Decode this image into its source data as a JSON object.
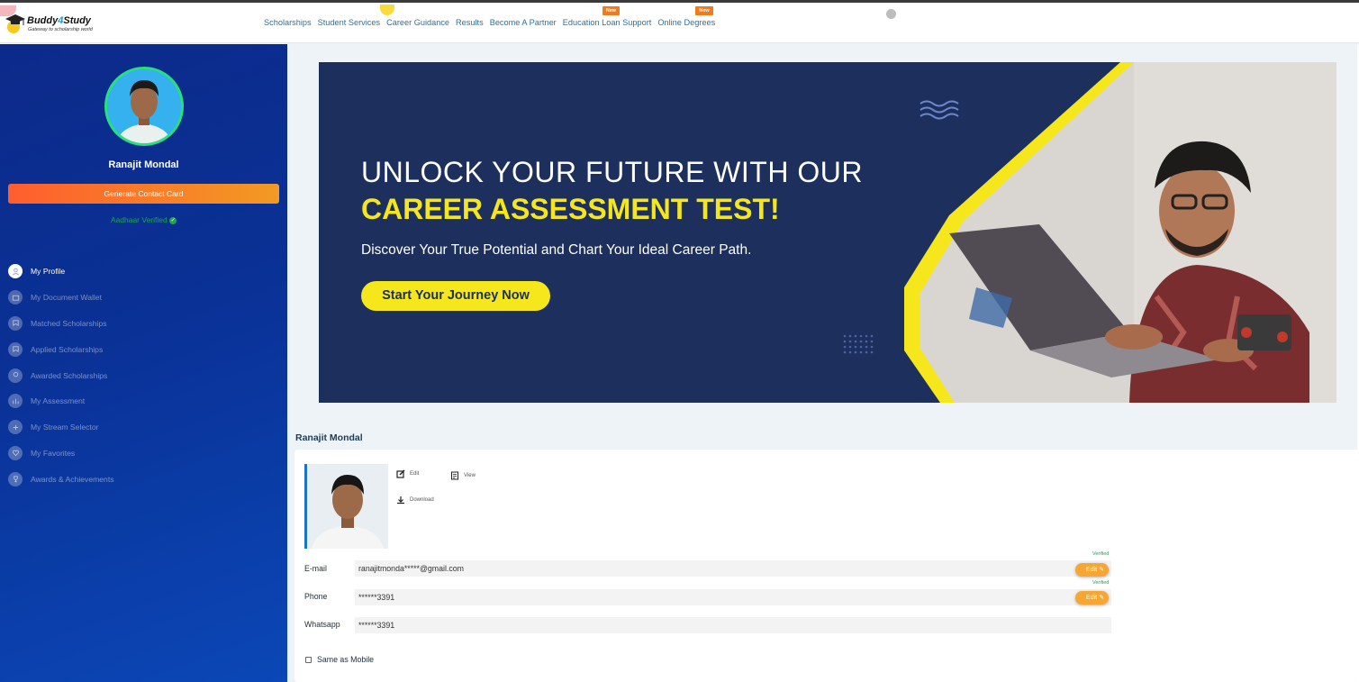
{
  "header": {
    "logo": {
      "name_main": "Buddy",
      "name_num": "4",
      "name_end": "Study",
      "tagline": "Gateway to scholarship world"
    },
    "nav": [
      {
        "label": "Scholarships",
        "badge": ""
      },
      {
        "label": "Student Services",
        "badge": ""
      },
      {
        "label": "Career Guidance",
        "badge": ""
      },
      {
        "label": "Results",
        "badge": ""
      },
      {
        "label": "Become A Partner",
        "badge": ""
      },
      {
        "label": "Education Loan Support",
        "badge": "New"
      },
      {
        "label": "Online Degrees",
        "badge": "New"
      }
    ]
  },
  "sidebar": {
    "name": "Ranajit  Mondal",
    "contact_button": "Generate Contact Card",
    "aadhaar": "Aadhaar Verified",
    "menu": [
      {
        "label": "My Profile",
        "icon": "user-icon",
        "active": true
      },
      {
        "label": "My Document Wallet",
        "icon": "wallet-icon",
        "active": false
      },
      {
        "label": "Matched Scholarships",
        "icon": "scholarship-icon",
        "active": false
      },
      {
        "label": "Applied Scholarships",
        "icon": "scholarship-icon",
        "active": false
      },
      {
        "label": "Awarded Scholarships",
        "icon": "award-icon",
        "active": false
      },
      {
        "label": "My Assessment",
        "icon": "assessment-icon",
        "active": false
      },
      {
        "label": "My Stream Selector",
        "icon": "stream-icon",
        "active": false
      },
      {
        "label": "My Favorites",
        "icon": "favorite-icon",
        "active": false
      },
      {
        "label": "Awards & Achievements",
        "icon": "achievement-icon",
        "active": false
      }
    ]
  },
  "banner": {
    "line1": "UNLOCK YOUR FUTURE WITH OUR",
    "line2": "CAREER ASSESSMENT TEST!",
    "sub": "Discover Your True Potential and Chart Your Ideal Career Path.",
    "cta": "Start Your Journey Now",
    "colors": {
      "bg": "#1c2f5d",
      "accent": "#f5e71b"
    }
  },
  "profile": {
    "title": "Ranajit  Mondal",
    "actions": {
      "edit": "Edit",
      "view": "View",
      "download": "Download"
    },
    "fields": {
      "email": {
        "label": "E-mail",
        "value": "ranajitmonda*****@gmail.com",
        "status": "Verified",
        "edit": "Edit"
      },
      "phone": {
        "label": "Phone",
        "value": "******3391",
        "status": "Verified",
        "edit": "Edit"
      },
      "whatsapp": {
        "label": "Whatsapp",
        "value": "******3391"
      }
    },
    "same_as_mobile": "Same as Mobile"
  },
  "colors": {
    "sidebar": "#0a3196",
    "nav_text": "#2f6f9f",
    "verified": "#1ea548",
    "edit_pill": "#f7a731",
    "new_badge": "#f07b1d"
  }
}
